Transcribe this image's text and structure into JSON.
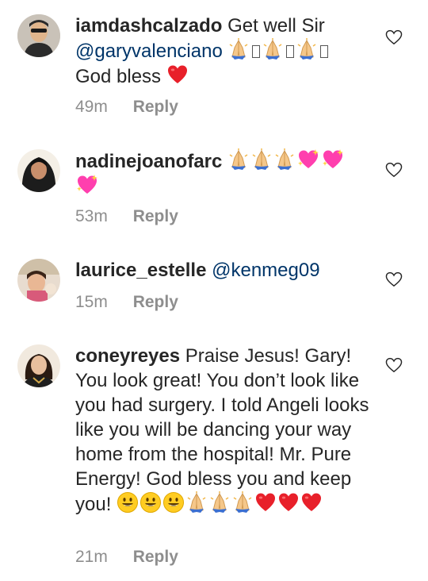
{
  "comments": [
    {
      "username": "iamdashcalzado",
      "text_lines": [
        "Get well Sir"
      ],
      "mention": "@garyvalenciano",
      "closing_text": "God bless",
      "time": "49m",
      "reply_label": "Reply"
    },
    {
      "username": "nadinejoanofarc",
      "text_lines": [],
      "time": "53m",
      "reply_label": "Reply"
    },
    {
      "username": "laurice_estelle",
      "mention": "@kenmeg09",
      "time": "15m",
      "reply_label": "Reply"
    },
    {
      "username": "coneyreyes",
      "text": "Praise Jesus! Gary! You look great! You don’t look like you had surgery. I told Angeli looks like you will be dancing your way home from the hospital! Mr. Pure Energy! God bless you and keep you!",
      "time": "21m",
      "reply_label": "Reply"
    }
  ],
  "icons": {
    "like": "heart-outline-icon",
    "pray": "folded-hands-emoji",
    "heart": "red-heart-emoji",
    "sparkle_heart": "sparkling-heart-emoji",
    "smile": "grinning-face-emoji"
  },
  "colors": {
    "text": "#262626",
    "meta": "#8e8e8e",
    "mention": "#003569",
    "heart": "#e8202a",
    "sparkle_heart": "#ff3fae",
    "smile": "#ffcc22"
  }
}
